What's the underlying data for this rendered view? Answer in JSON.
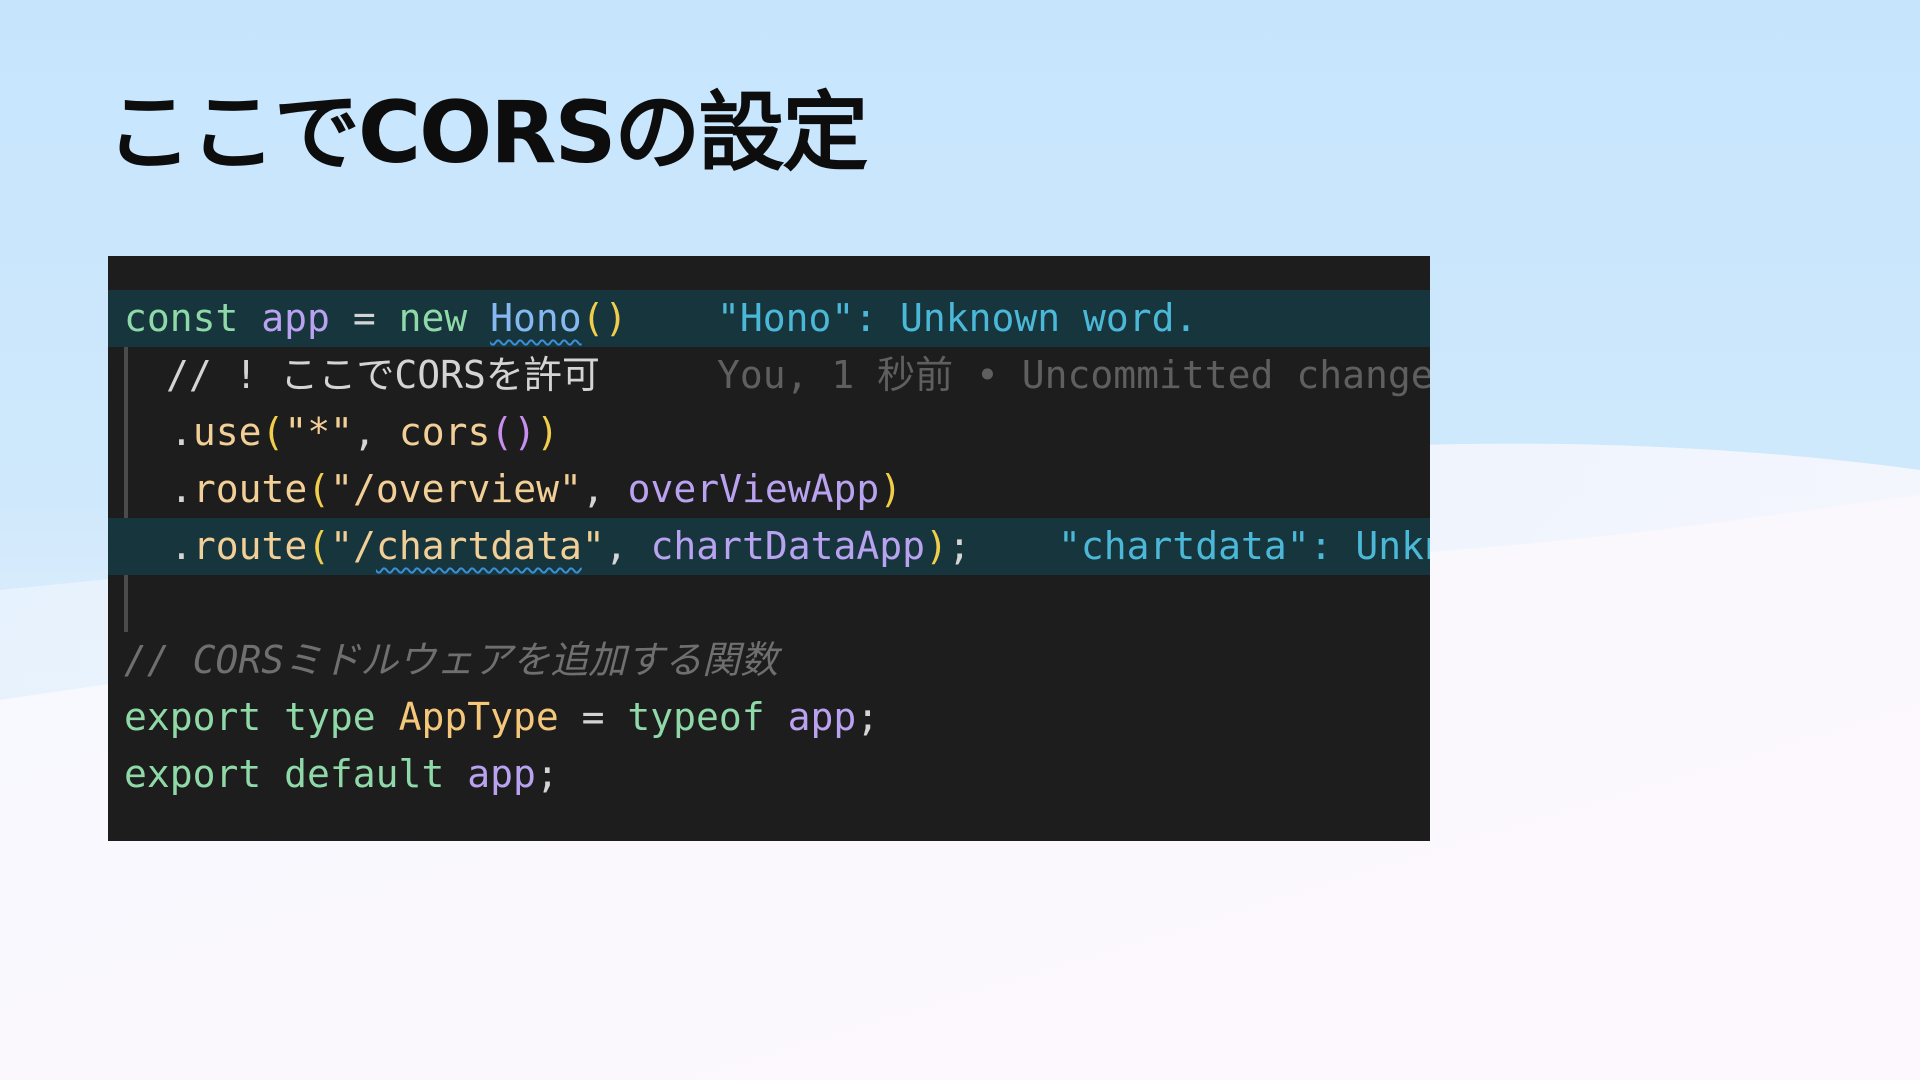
{
  "slide": {
    "title": "ここでCORSの設定"
  },
  "code": {
    "line1": {
      "kw_const": "const",
      "var_app": "app",
      "op_eq": "=",
      "kw_new": "new",
      "class_hono": "Hono",
      "parens": "()",
      "diagnostic": "\"Hono\": Unknown word."
    },
    "line2": {
      "comment": "// ! ここでCORSを許可",
      "blame": "You, 1 秒前 • Uncommitted change"
    },
    "line3": {
      "dot": ".",
      "method_use": "use",
      "open_paren": "(",
      "string_star": "\"*\"",
      "comma": ",",
      "fn_cors": "cors",
      "inner_parens": "()",
      "close_paren": ")"
    },
    "line4": {
      "dot": ".",
      "method_route": "route",
      "open_paren": "(",
      "string_path": "\"/overview\"",
      "comma": ",",
      "var_app": "overViewApp",
      "close_paren": ")"
    },
    "line5": {
      "dot": ".",
      "method_route": "route",
      "open_paren": "(",
      "string_quote_open": "\"/",
      "string_word": "chartdata",
      "string_quote_close": "\"",
      "comma": ",",
      "var_app": "chartDataApp",
      "close_paren": ")",
      "semicolon": ";",
      "diagnostic": "\"chartdata\": Unknown word."
    },
    "line7": {
      "comment": "// CORSミドルウェアを追加する関数"
    },
    "line8": {
      "kw_export": "export",
      "kw_type": "type",
      "type_name": "AppType",
      "op_eq": "=",
      "kw_typeof": "typeof",
      "var_app": "app",
      "semicolon": ";"
    },
    "line9": {
      "kw_export": "export",
      "kw_default": "default",
      "var_app": "app",
      "semicolon": ";"
    }
  }
}
